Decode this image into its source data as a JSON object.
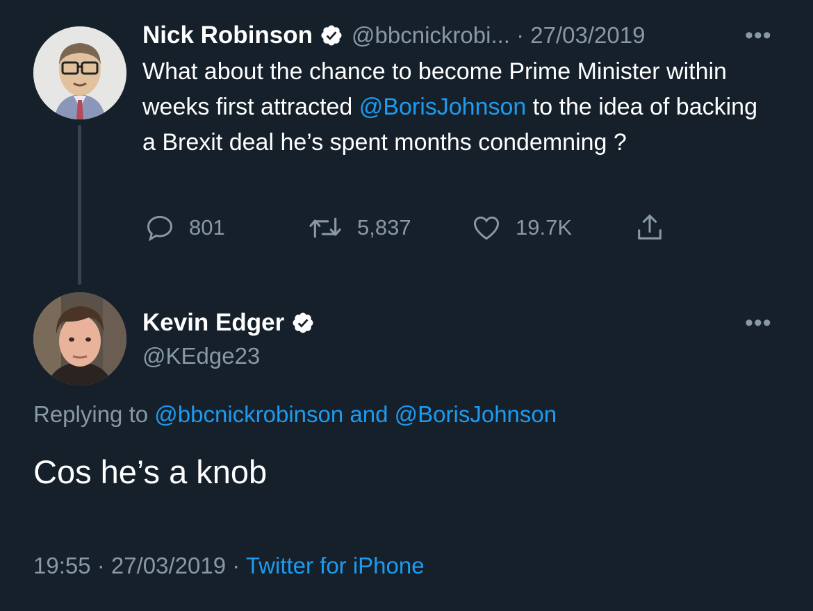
{
  "original_tweet": {
    "author_name": "Nick Robinson",
    "handle_date": "@bbcnickrobi... · 27/03/2019",
    "more_label": "•••",
    "text_part1": "What about the chance to become Prime Minister within weeks first attracted ",
    "mention": "@BorisJohnson",
    "text_part2": " to the idea of backing a Brexit deal he’s spent months condemning ?",
    "replies": "801",
    "retweets": "5,837",
    "likes": "19.7K"
  },
  "reply_tweet": {
    "author_name": "Kevin Edger",
    "handle": "@KEdge23",
    "more_label": "•••",
    "replying_prefix": "Replying to ",
    "replying_to_1": "@bbcnickrobinson",
    "replying_and": " and ",
    "replying_to_2": "@BorisJohnson",
    "text": "Cos he’s a knob",
    "time": "19:55 · 27/03/2019 · ",
    "source": "Twitter for iPhone"
  },
  "colors": {
    "background": "#15202b",
    "accent": "#1d9bf0",
    "muted": "#8899a6"
  }
}
